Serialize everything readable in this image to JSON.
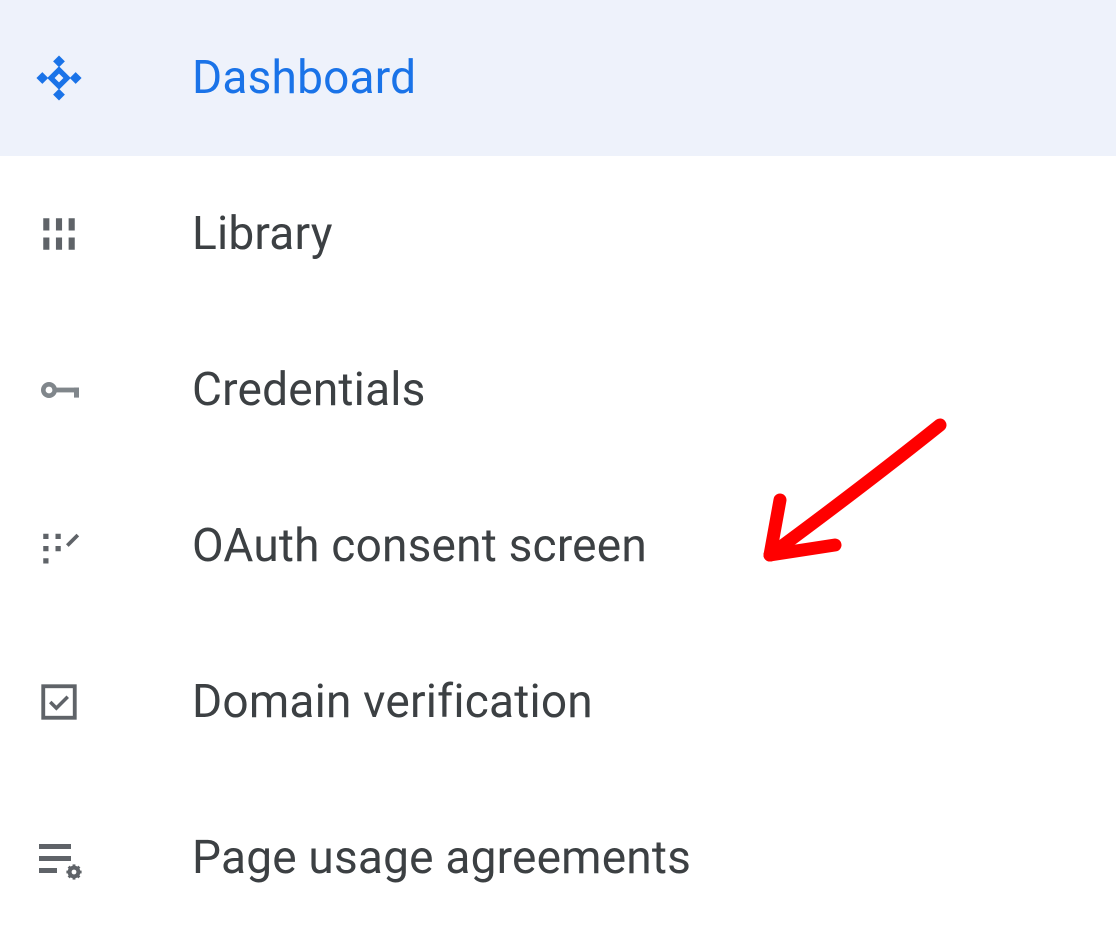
{
  "sidebar": {
    "items": [
      {
        "label": "Dashboard",
        "icon": "dashboard-icon",
        "active": true
      },
      {
        "label": "Library",
        "icon": "library-icon",
        "active": false
      },
      {
        "label": "Credentials",
        "icon": "key-icon",
        "active": false
      },
      {
        "label": "OAuth consent screen",
        "icon": "consent-icon",
        "active": false
      },
      {
        "label": "Domain verification",
        "icon": "checkbox-icon",
        "active": false
      },
      {
        "label": "Page usage agreements",
        "icon": "list-settings-icon",
        "active": false
      }
    ]
  },
  "annotation": {
    "type": "arrow",
    "color": "#ff0000",
    "target": "oauth-consent-screen"
  }
}
